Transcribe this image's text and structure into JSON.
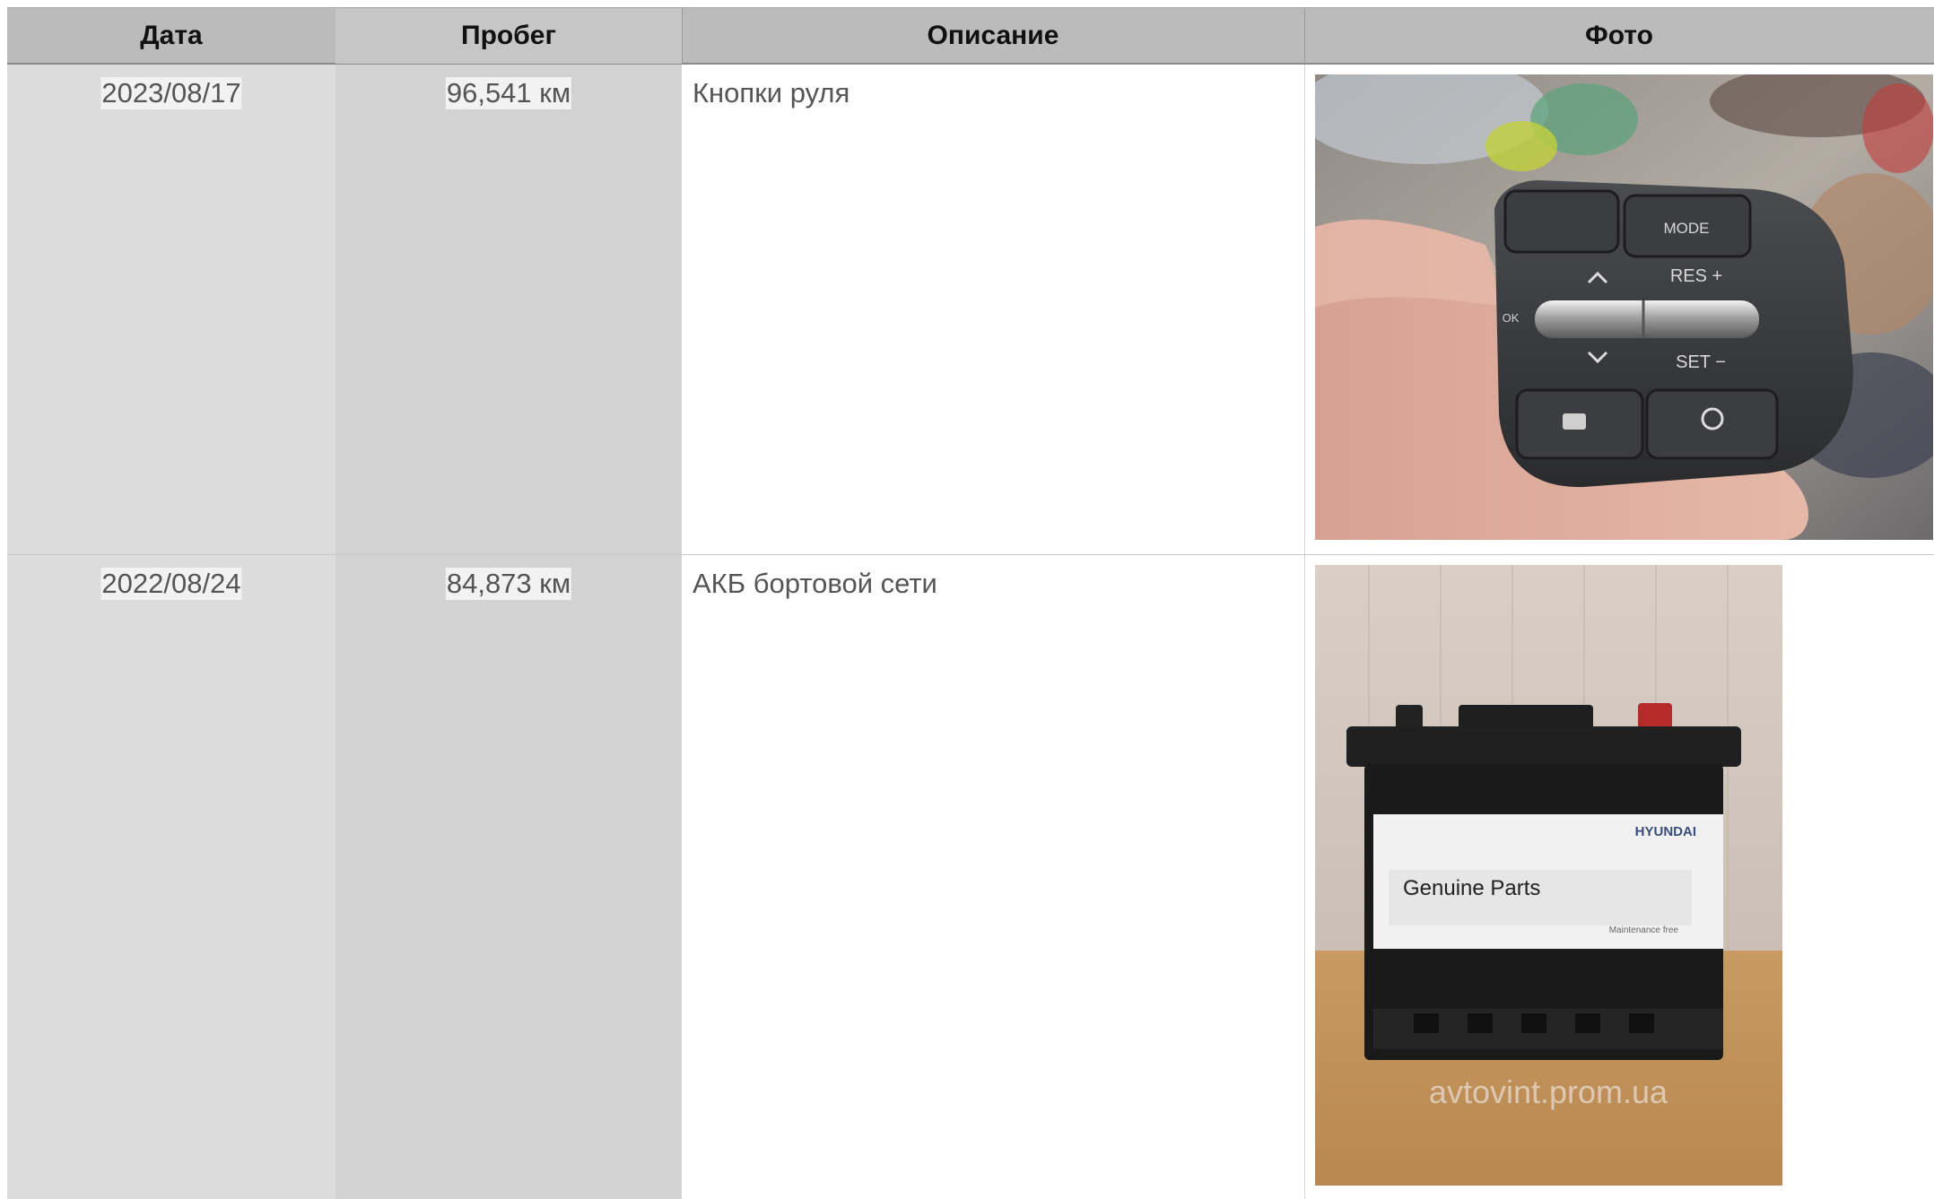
{
  "table": {
    "headers": {
      "date": "Дата",
      "mileage": "Пробег",
      "description": "Описание",
      "photo": "Фото"
    },
    "rows": [
      {
        "date": "2023/08/17",
        "mileage": "96,541 км",
        "description": "Кнопки руля",
        "photo": {
          "subject": "steering-wheel-buttons-photo",
          "labels": {
            "mode": "MODE",
            "res": "RES +",
            "set": "SET −",
            "ok": "OK"
          }
        }
      },
      {
        "date": "2022/08/24",
        "mileage": "84,873 км",
        "description": "АКБ бортовой сети",
        "photo": {
          "subject": "car-battery-photo",
          "labels": {
            "brand": "HYUNDAI",
            "product": "Genuine Parts",
            "note": "Maintenance free",
            "watermark": "avtovint.prom.ua"
          }
        }
      }
    ]
  }
}
